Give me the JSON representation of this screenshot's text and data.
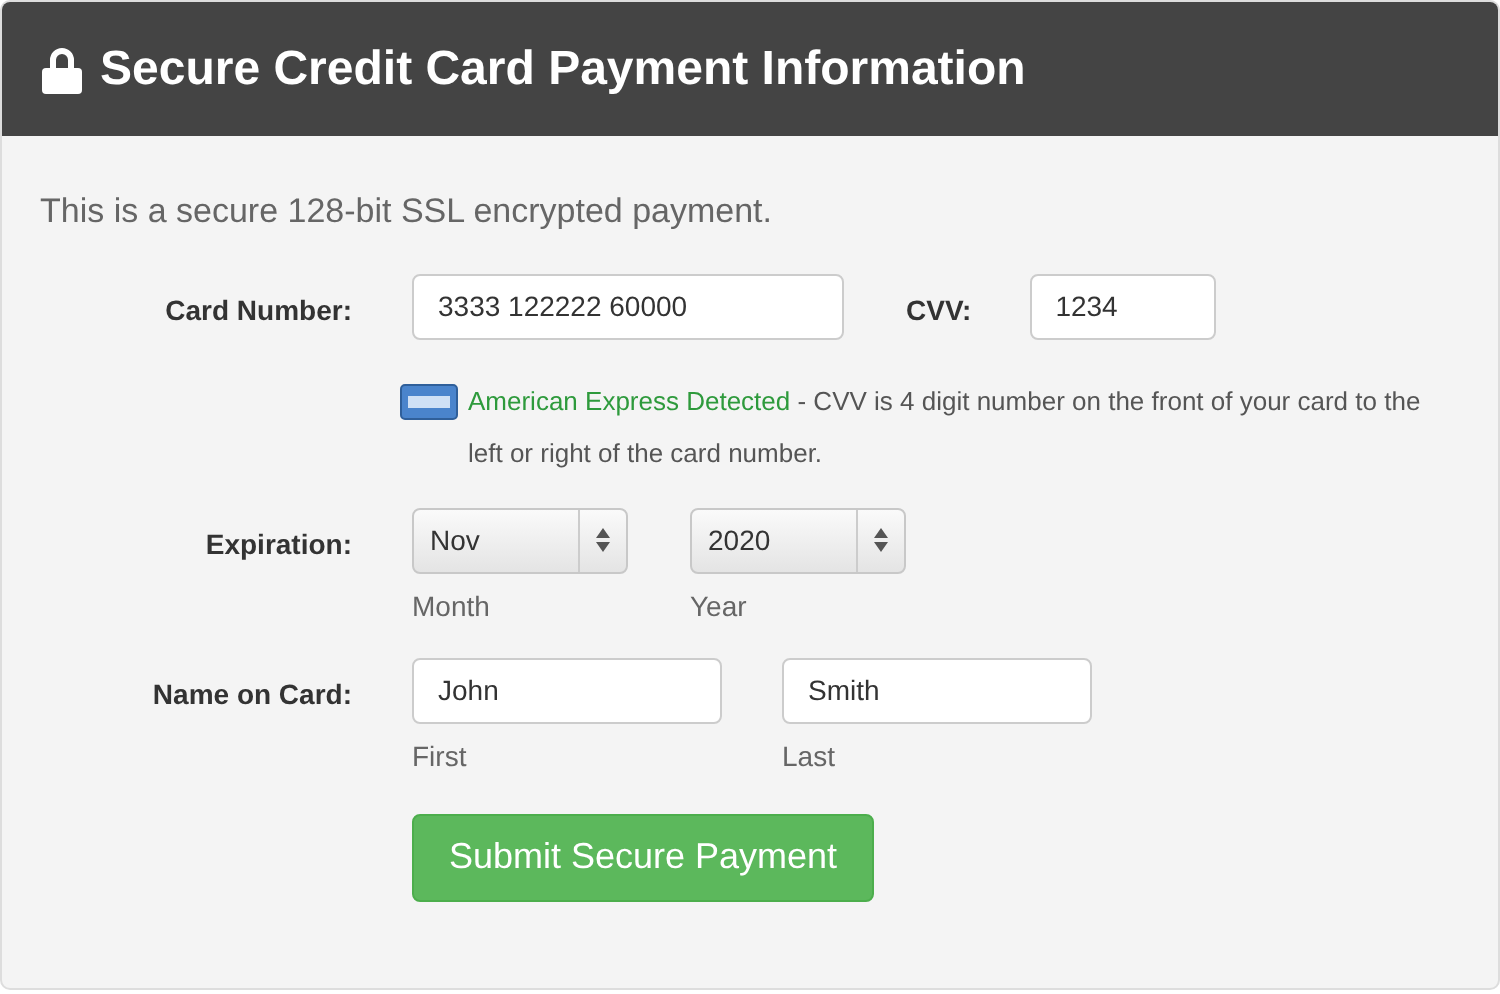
{
  "header": {
    "title": "Secure Credit Card Payment Information"
  },
  "intro": "This is a secure 128-bit SSL encrypted payment.",
  "card_number": {
    "label": "Card Number:",
    "value": "3333 122222 60000"
  },
  "cvv": {
    "label": "CVV:",
    "value": "1234"
  },
  "card_detection": {
    "detected": "American Express Detected",
    "note": " - CVV is 4 digit number on the front of your card to the left or right of the card number."
  },
  "expiration": {
    "label": "Expiration:",
    "month": {
      "value": "Nov",
      "caption": "Month"
    },
    "year": {
      "value": "2020",
      "caption": "Year"
    }
  },
  "name_on_card": {
    "label": "Name on Card:",
    "first": {
      "value": "John",
      "caption": "First"
    },
    "last": {
      "value": "Smith",
      "caption": "Last"
    }
  },
  "submit": "Submit Secure Payment"
}
